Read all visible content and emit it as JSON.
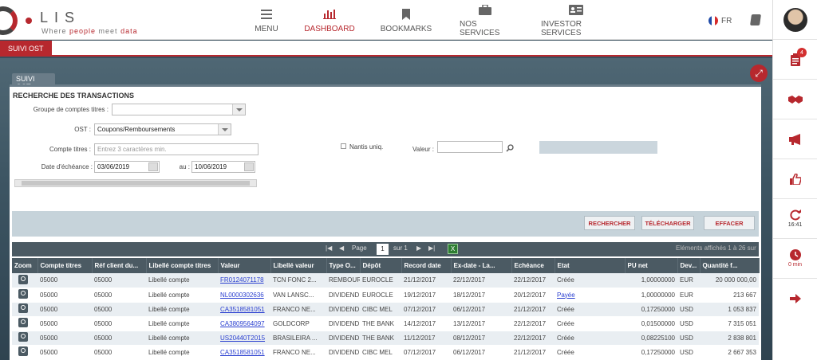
{
  "header": {
    "brand": "LIS",
    "tagline_prefix": "Where ",
    "tagline_accent1": "people",
    "tagline_mid": " meet ",
    "tagline_accent2": "data",
    "nav": [
      {
        "label": "MENU",
        "icon": "menu-icon"
      },
      {
        "label": "DASHBOARD",
        "icon": "bar-chart-icon",
        "active": true
      },
      {
        "label": "BOOKMARKS",
        "icon": "bookmark-icon"
      },
      {
        "label": "NOS SERVICES",
        "icon": "briefcase-icon"
      },
      {
        "label": "INVESTOR SERVICES",
        "icon": "id-card-icon"
      }
    ],
    "lang": "FR"
  },
  "sidebar": {
    "notifications_count": "4",
    "time": "16:41",
    "timer": "0 min"
  },
  "tabbar": {
    "active_tab": "SUIVI OST"
  },
  "panel": {
    "tab": "SUIVI OST",
    "title": "RECHERCHE DES TRANSACTIONS",
    "groupe_label": "Groupe de comptes titres :",
    "groupe_value": "",
    "ost_label": "OST :",
    "ost_value": "Coupons/Remboursements",
    "compte_label": "Compte titres :",
    "compte_placeholder": "Entrez 3 caractères min.",
    "nantis_label": "Nantis uniq.",
    "valeur_label": "Valeur :",
    "date_label": "Date d'échéance :",
    "date_from": "03/06/2019",
    "au_label": "au :",
    "date_to": "10/06/2019",
    "buttons": {
      "search": "RECHERCHER",
      "download": "TÉLÉCHARGER",
      "clear": "EFFACER"
    }
  },
  "pager": {
    "page_label": "Page",
    "page": "1",
    "of_label": "sur 1",
    "summary": "Eléments affichés 1 à 26 sur"
  },
  "table": {
    "headers": [
      "Zoom",
      "Compte titres",
      "Réf client du...",
      "Libellé compte titres",
      "Valeur",
      "Libellé valeur",
      "Type O...",
      "Dépôt",
      "Record date",
      "Ex-date - La...",
      "Echéance",
      "Etat",
      "PU net",
      "Dev...",
      "Quantité f..."
    ],
    "rows": [
      [
        "05000",
        "05000",
        "Libellé compte",
        "FR0124071178",
        "TCN FONC 2...",
        "REMBOUR",
        "EUROCLE",
        "21/12/2017",
        "22/12/2017",
        "22/12/2017",
        "Créée",
        "1,00000000",
        "EUR",
        "20 000 000,00"
      ],
      [
        "05000",
        "05000",
        "Libellé compte",
        "NL0000302636",
        "VAN LANSC...",
        "DIVIDEND",
        "EUROCLE",
        "19/12/2017",
        "18/12/2017",
        "20/12/2017",
        "Payée",
        "1,00000000",
        "EUR",
        "213 667"
      ],
      [
        "05000",
        "05000",
        "Libellé compte",
        "CA3518581051",
        "FRANCO NE...",
        "DIVIDEND",
        "CIBC MEL",
        "07/12/2017",
        "06/12/2017",
        "21/12/2017",
        "Créée",
        "0,17250000",
        "USD",
        "1 053 837"
      ],
      [
        "05000",
        "05000",
        "Libellé compte",
        "CA3809564097",
        "GOLDCORP",
        "DIVIDEND",
        "THE BANK",
        "14/12/2017",
        "13/12/2017",
        "22/12/2017",
        "Créée",
        "0,01500000",
        "USD",
        "7 315 051"
      ],
      [
        "05000",
        "05000",
        "Libellé compte",
        "US20440T2015",
        "BRASILEIRA ...",
        "DIVIDEND",
        "THE BANK",
        "11/12/2017",
        "08/12/2017",
        "22/12/2017",
        "Créée",
        "0,08225100",
        "USD",
        "2 838 801"
      ],
      [
        "05000",
        "05000",
        "Libellé compte",
        "CA3518581051",
        "FRANCO NE...",
        "DIVIDEND",
        "CIBC MEL",
        "07/12/2017",
        "06/12/2017",
        "21/12/2017",
        "Créée",
        "0,17250000",
        "USD",
        "2 667 353"
      ]
    ]
  }
}
